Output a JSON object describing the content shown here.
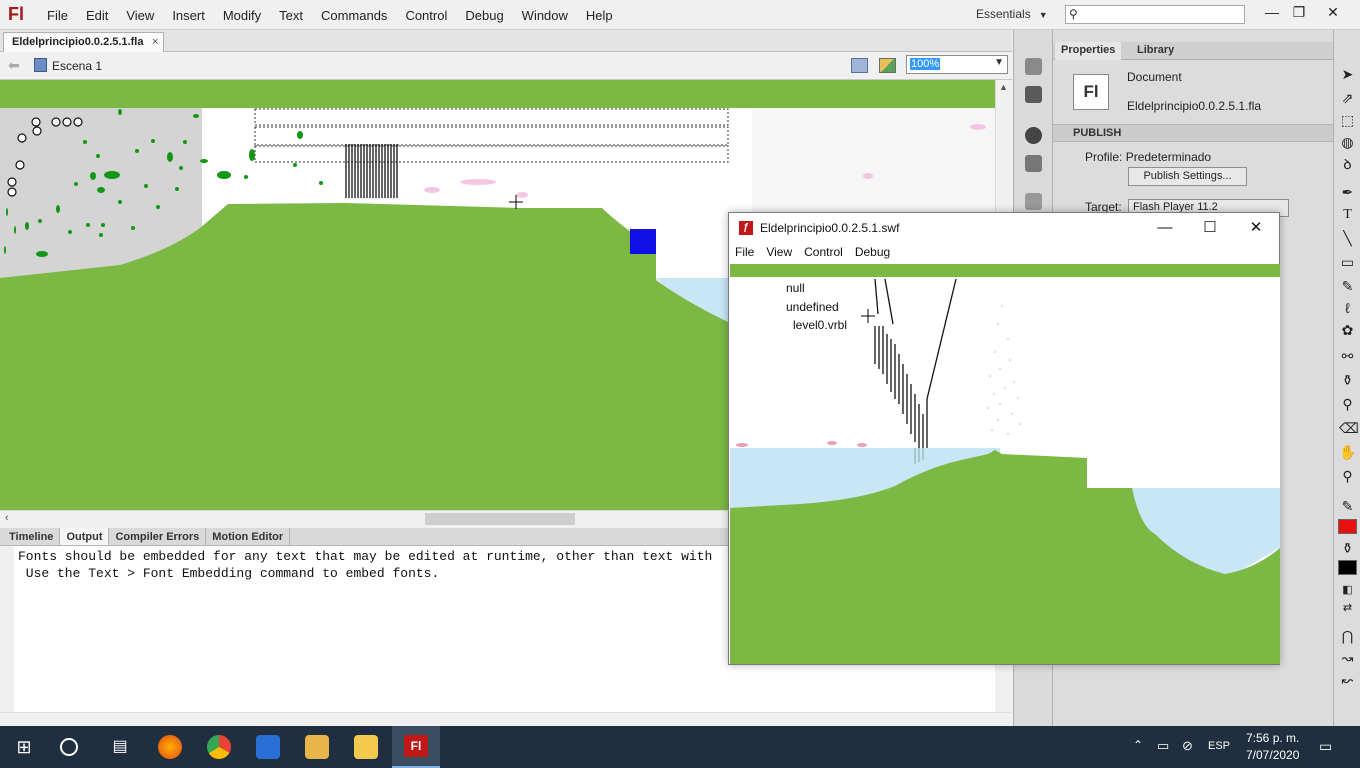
{
  "app": {
    "logo": "Fl",
    "menus": [
      "File",
      "Edit",
      "View",
      "Insert",
      "Modify",
      "Text",
      "Commands",
      "Control",
      "Debug",
      "Window",
      "Help"
    ],
    "workspace": "Essentials",
    "search_placeholder": ""
  },
  "document": {
    "tab_name": "Eldelprincipio0.0.2.5.1.fla",
    "scene": "Escena 1",
    "zoom": "100%"
  },
  "bottom_panel": {
    "tabs": [
      "Timeline",
      "Output",
      "Compiler Errors",
      "Motion Editor"
    ],
    "active_tab": "Output",
    "output_lines": [
      "Fonts should be embedded for any text that may be edited at runtime, other than text with",
      " Use the Text > Font Embedding command to embed fonts."
    ]
  },
  "properties": {
    "tabs": [
      "Properties",
      "Library"
    ],
    "doc_icon": "Fl",
    "doc_type": "Document",
    "doc_name": "Eldelprincipio0.0.2.5.1.fla",
    "publish_section": "PUBLISH",
    "profile_label": "Profile:",
    "profile_value": "Predeterminado",
    "publish_settings_button": "Publish Settings...",
    "target_label": "Target:",
    "target_value": "Flash Player 11.2"
  },
  "swf_window": {
    "title": "Eldelprincipio0.0.2.5.1.swf",
    "menus": [
      "File",
      "View",
      "Control",
      "Debug"
    ],
    "trace_text": [
      "null",
      "undefined",
      "level0.vrbl"
    ]
  },
  "taskbar": {
    "language": "ESP",
    "time": "7:56 p. m.",
    "date": "7/07/2020"
  },
  "colors": {
    "ground_green": "#7cb944",
    "water_blue": "#c9e6f7",
    "object_blue": "#1010e6",
    "leaf_green": "#139613",
    "stroke_color": "#e81010",
    "taskbar": "#1f2f3f"
  }
}
